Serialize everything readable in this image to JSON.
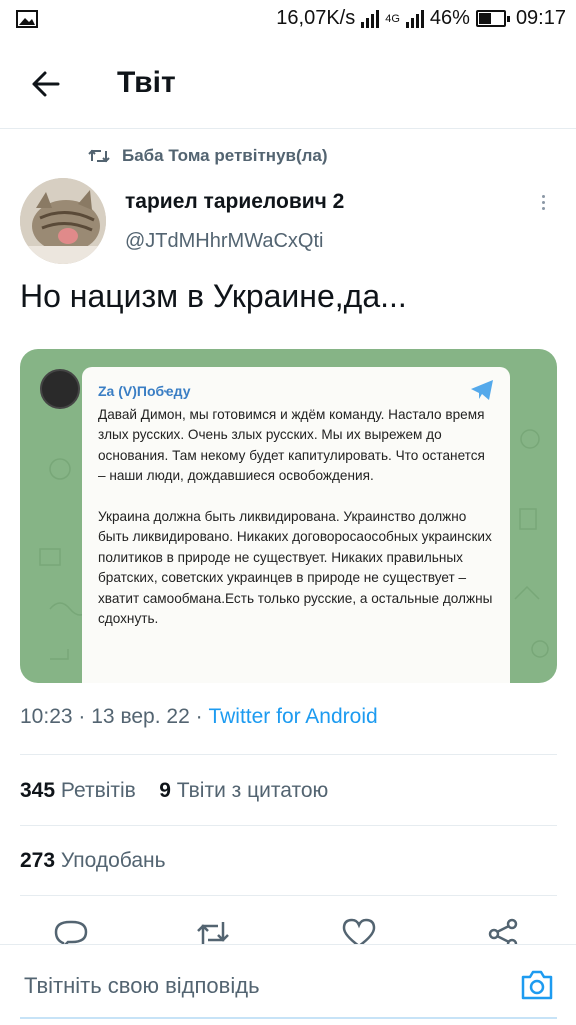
{
  "status_bar": {
    "speed": "16,07K/s",
    "network": "4G",
    "battery": "46%",
    "time": "09:17",
    "icons": [
      "image-icon",
      "wifi-signal-icon",
      "cell-signal-icon",
      "battery-icon"
    ]
  },
  "header": {
    "title": "Твіт",
    "back_icon": "arrow-left-icon"
  },
  "retweet": {
    "label": "Баба Тома ретвітнув(ла)",
    "icon": "retweet-icon"
  },
  "author": {
    "name": "тариел тариелович 2",
    "handle": "@JTdMHhrMWaCxQti"
  },
  "tweet": {
    "text": "Но нацизм в Украине,да..."
  },
  "media": {
    "channel": "Za (V)Побҽду",
    "paragraph1": "Давай Димон, мы готовимся и ждём команду. Настало время злых русских. Очень злых русских. Мы их вырежем до основания. Там некому будет капитулировать. Что останется – наши люди, дождавшиеся освобождения.",
    "paragraph2": "Украина должна быть ликвидирована. Украинство должно быть ликвидировано. Никаких договоросаособных украинских политиков в природе не существует. Никаких правильных братских, советских украинцев в природе не существует – хватит самообмана.Есть только русские, а остальные должны сдохнуть.",
    "background_color": "#86b486"
  },
  "meta": {
    "time": "10:23",
    "date": "13 вер. 22",
    "source": "Twitter for Android",
    "sep": "·"
  },
  "stats": {
    "retweets_count": "345",
    "retweets_label": "Ретвітів",
    "quotes_count": "9",
    "quotes_label": "Твіти з цитатою",
    "likes_count": "273",
    "likes_label": "Уподобань"
  },
  "actions": [
    "reply-icon",
    "retweet-icon",
    "like-icon",
    "share-icon"
  ],
  "reply_bar": {
    "placeholder": "Твітніть свою відповідь",
    "camera_icon": "camera-icon"
  },
  "colors": {
    "accent": "#1d9bf0",
    "secondary_text": "#536471"
  }
}
